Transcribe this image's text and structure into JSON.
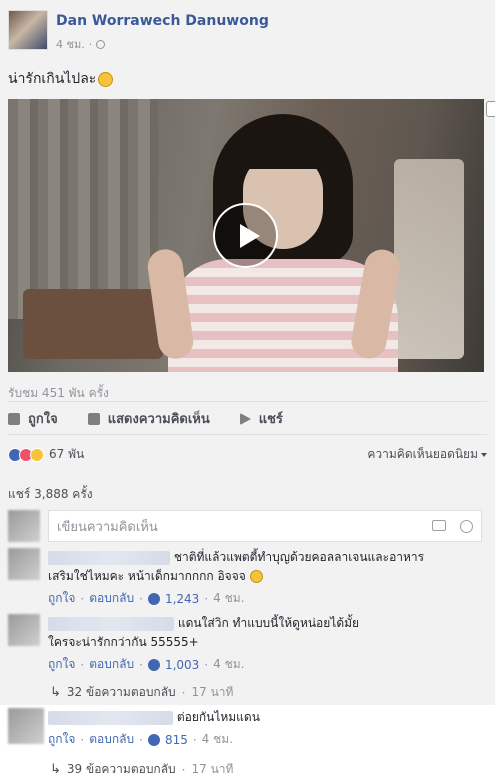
{
  "post": {
    "author": "Dan Worrawech Danuwong",
    "time": "4 ชม.",
    "text": "น่ารักเกินไปละ",
    "views": "รับชม 451 พัน ครั้ง"
  },
  "actions": {
    "like": "ถูกใจ",
    "comment": "แสดงความคิดเห็น",
    "share": "แชร์"
  },
  "reactions": {
    "count": "67 พัน",
    "sort_label": "ความคิดเห็นยอดนิยม"
  },
  "shares": "แชร์ 3,888 ครั้ง",
  "composer": {
    "placeholder": "เขียนความคิดเห็น"
  },
  "comments": [
    {
      "text_line1": "ชาติที่แล้วแพตตี้ทำบุญด้วยคอลลาเจนและอาหาร",
      "text_line2": "เสริมใช่ไหมคะ หน้าเด็กมากกกก อิจจจ",
      "like": "ถูกใจ",
      "reply": "ตอบกลับ",
      "likes": "1,243",
      "time": "4 ชม."
    },
    {
      "text_line1": "แดนใส่วิก ทำแบบนี้ให้ดูหน่อยได้มั้ย",
      "text_line2": "ใครจะน่ารักกว่ากัน 55555+",
      "like": "ถูกใจ",
      "reply": "ตอบกลับ",
      "likes": "1,003",
      "time": "4 ชม.",
      "replies": "32 ข้อความตอบกลับ",
      "replies_time": "17 นาที"
    },
    {
      "text_line1": "ต่อยกันไหมแดน",
      "like": "ถูกใจ",
      "reply": "ตอบกลับ",
      "likes": "815",
      "time": "4 ชม.",
      "replies": "39 ข้อความตอบกลับ",
      "replies_time": "17 นาที"
    }
  ]
}
